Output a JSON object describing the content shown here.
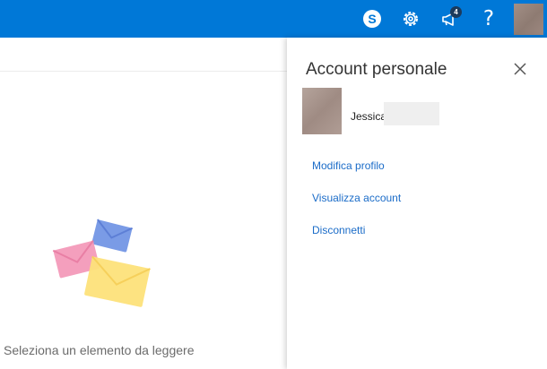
{
  "header": {
    "background_color": "#0078d7",
    "icons": [
      {
        "name": "skype-icon"
      },
      {
        "name": "gear-icon"
      },
      {
        "name": "megaphone-icon",
        "badge": "4"
      },
      {
        "name": "help-icon",
        "glyph": "?"
      }
    ]
  },
  "reading_pane": {
    "empty_message": "Seleziona un elemento da leggere"
  },
  "account_panel": {
    "title": "Account personale",
    "user_name": "Jessica",
    "links": [
      "Modifica profilo",
      "Visualizza account",
      "Disconnetti"
    ],
    "link_color": "#1b6cc8"
  }
}
